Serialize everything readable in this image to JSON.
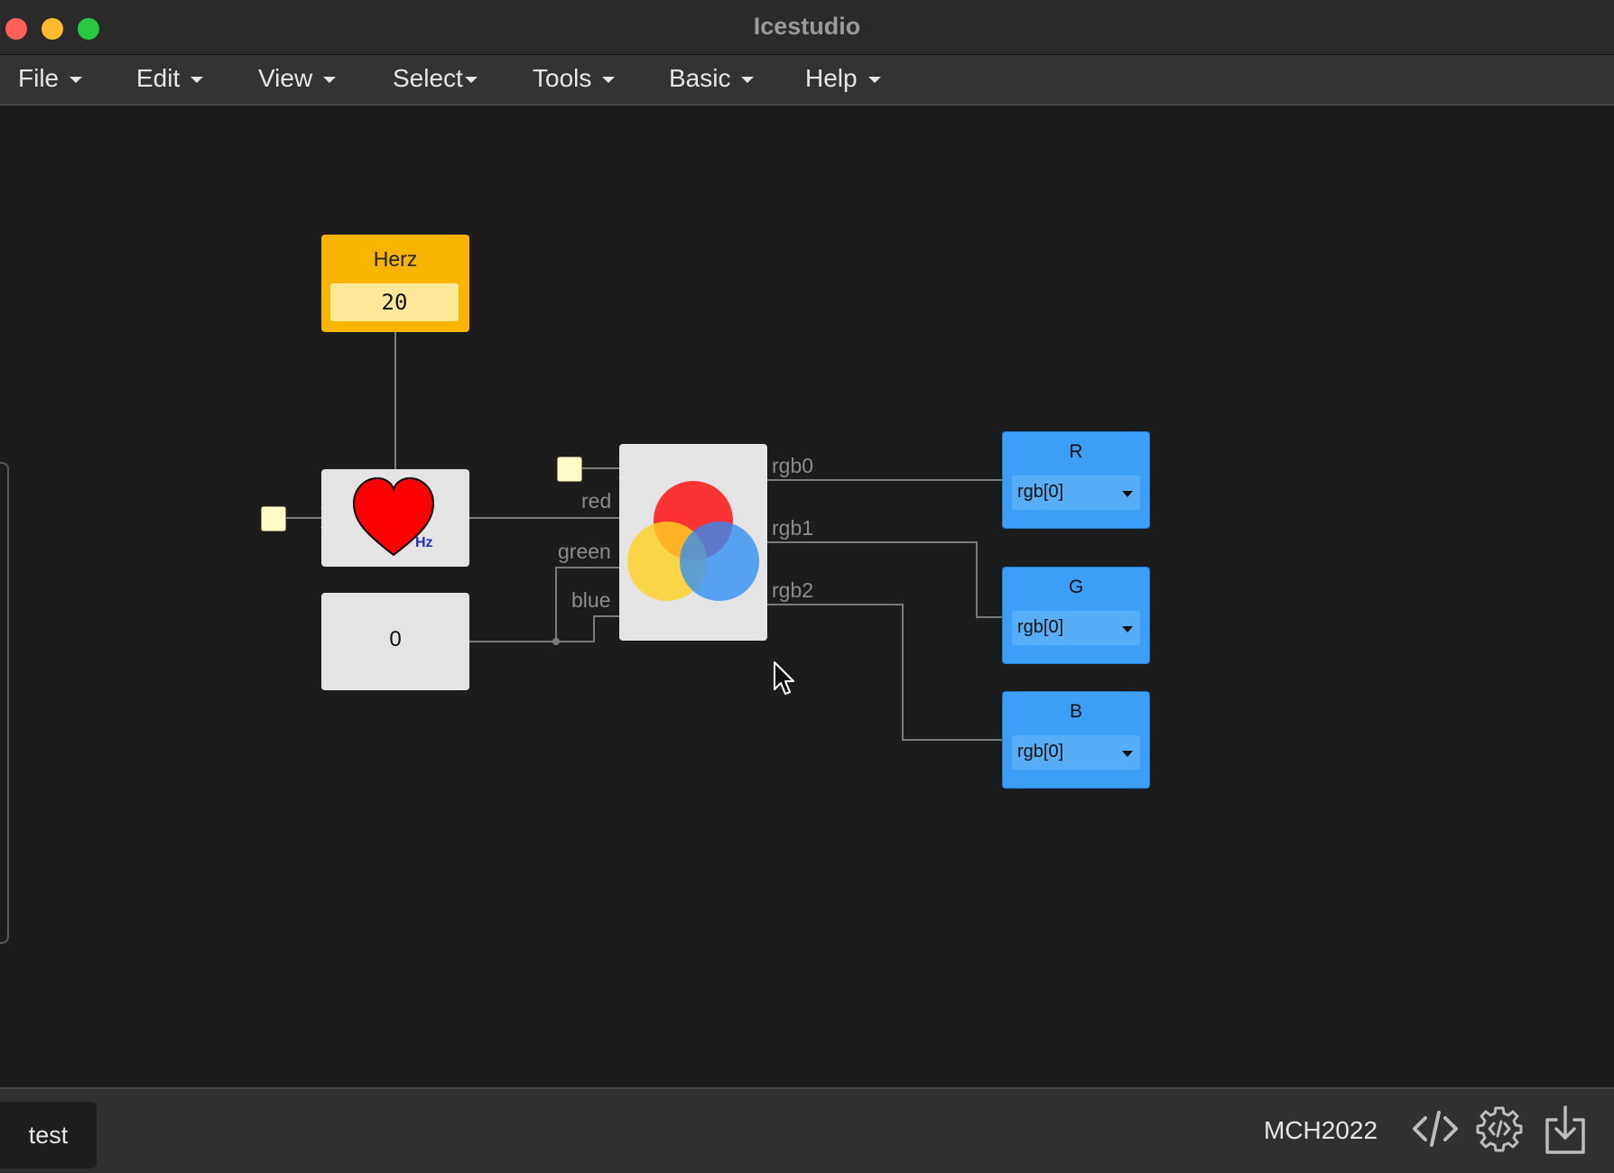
{
  "window": {
    "title": "Icestudio"
  },
  "menu": [
    {
      "label": "File"
    },
    {
      "label": "Edit"
    },
    {
      "label": "View"
    },
    {
      "label": "Select"
    },
    {
      "label": "Tools"
    },
    {
      "label": "Basic"
    },
    {
      "label": "Help"
    }
  ],
  "blocks": {
    "herz": {
      "label": "Herz",
      "value": "20"
    },
    "heart": {
      "unit": "Hz",
      "icon": "heart-icon"
    },
    "constant": {
      "value": "0"
    },
    "rgb": {
      "icon": "rgb-circles-icon",
      "inputs": [
        "red",
        "green",
        "blue"
      ],
      "outputs": [
        "rgb0",
        "rgb1",
        "rgb2"
      ]
    }
  },
  "outputs": [
    {
      "label": "R",
      "value": "rgb[0]"
    },
    {
      "label": "G",
      "value": "rgb[0]"
    },
    {
      "label": "B",
      "value": "rgb[0]"
    }
  ],
  "statusbar": {
    "tab": "test",
    "board": "MCH2022",
    "icons": [
      "code-icon",
      "settings-gear-icon",
      "download-icon"
    ]
  },
  "colors": {
    "herz_block": "#f7b500",
    "output_block": "#3d9ef5",
    "canvas": "#1c1c1c"
  }
}
